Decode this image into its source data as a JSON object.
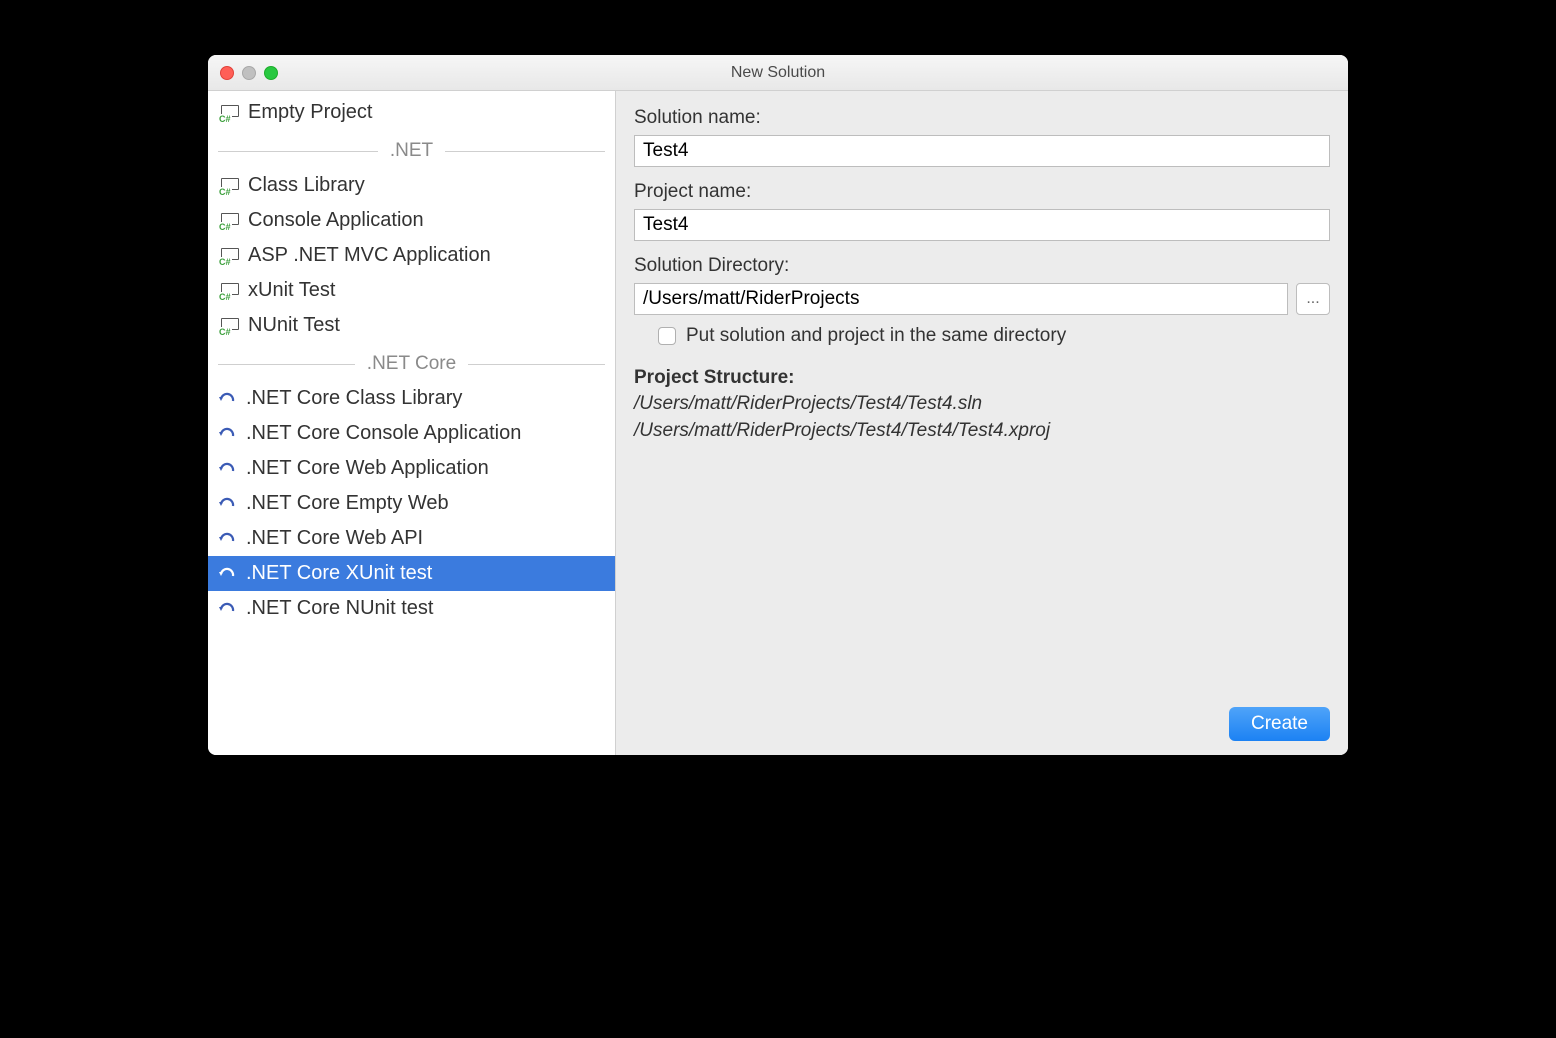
{
  "window": {
    "title": "New Solution"
  },
  "sidebar": {
    "top_items": [
      {
        "label": "Empty Project",
        "icon": "cs"
      }
    ],
    "sections": [
      {
        "header": ".NET",
        "items": [
          {
            "label": "Class Library",
            "icon": "cs"
          },
          {
            "label": "Console Application",
            "icon": "cs"
          },
          {
            "label": "ASP .NET MVC Application",
            "icon": "cs"
          },
          {
            "label": "xUnit Test",
            "icon": "cs"
          },
          {
            "label": "NUnit Test",
            "icon": "cs"
          }
        ]
      },
      {
        "header": ".NET Core",
        "items": [
          {
            "label": ".NET Core Class Library",
            "icon": "core"
          },
          {
            "label": ".NET Core Console Application",
            "icon": "core"
          },
          {
            "label": ".NET Core Web Application",
            "icon": "core"
          },
          {
            "label": ".NET Core Empty Web",
            "icon": "core"
          },
          {
            "label": ".NET Core Web API",
            "icon": "core"
          },
          {
            "label": ".NET Core XUnit test",
            "icon": "core",
            "selected": true
          },
          {
            "label": ".NET Core NUnit test",
            "icon": "core"
          }
        ]
      }
    ]
  },
  "form": {
    "solution_name_label": "Solution name:",
    "solution_name_value": "Test4",
    "project_name_label": "Project name:",
    "project_name_value": "Test4",
    "solution_dir_label": "Solution Directory:",
    "solution_dir_value": "/Users/matt/RiderProjects",
    "browse_label": "...",
    "same_dir_label": "Put solution and project in the same directory",
    "same_dir_checked": false,
    "structure_heading": "Project Structure:",
    "structure_lines": [
      "/Users/matt/RiderProjects/Test4/Test4.sln",
      "/Users/matt/RiderProjects/Test4/Test4/Test4.xproj"
    ],
    "create_label": "Create"
  }
}
